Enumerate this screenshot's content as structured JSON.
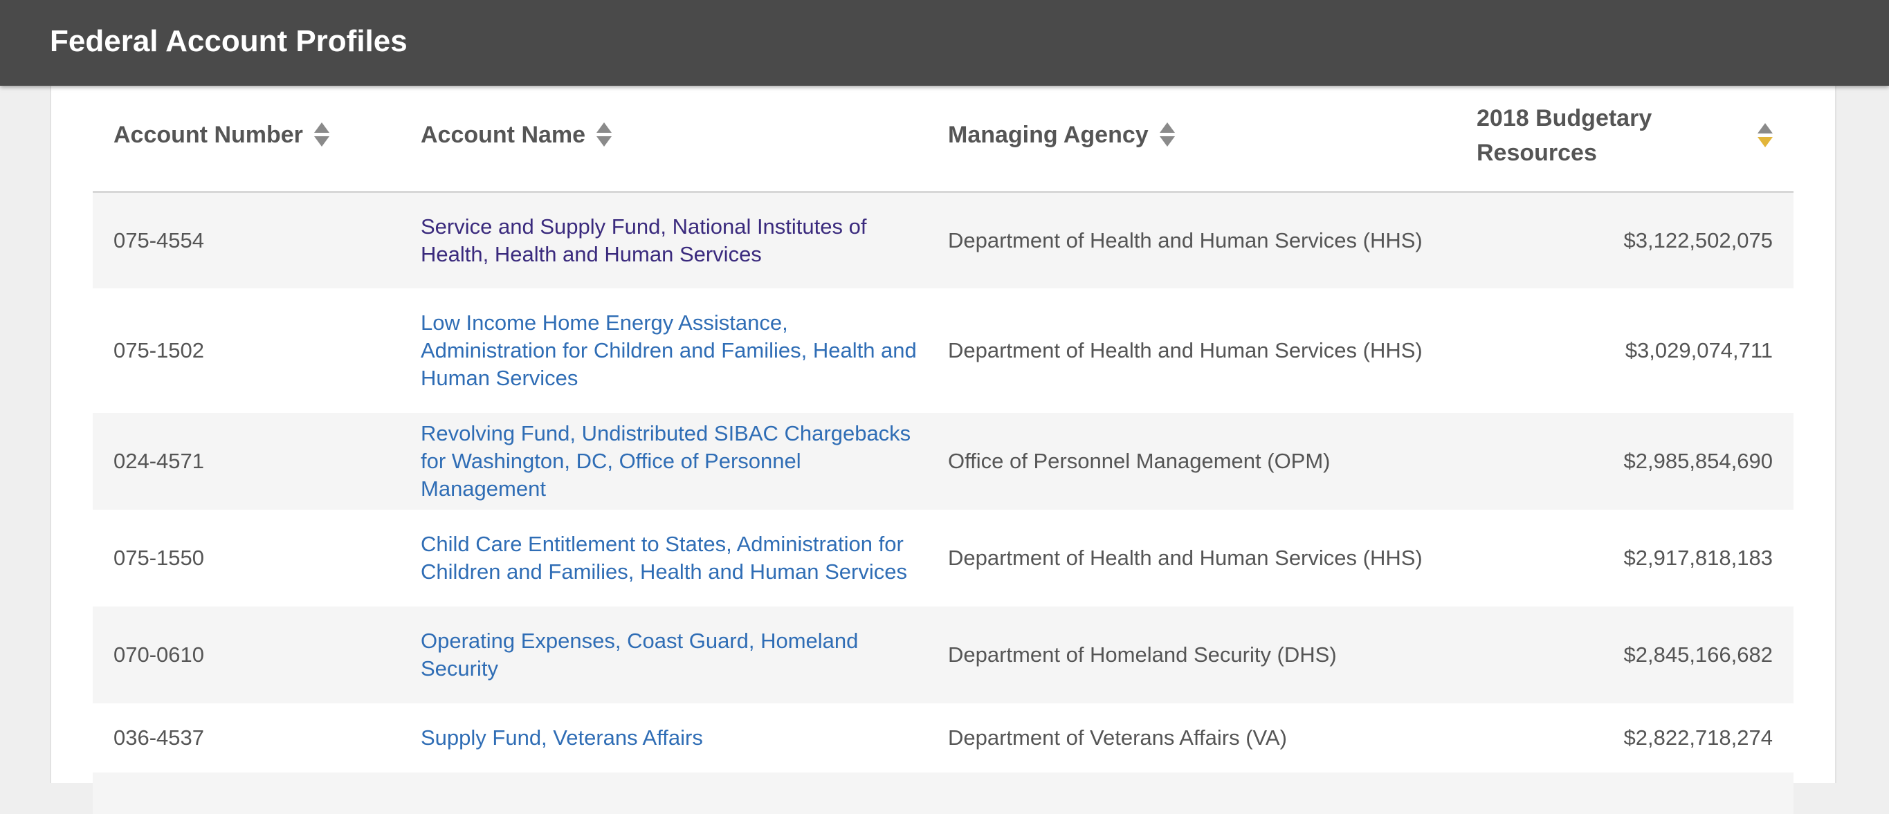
{
  "header": {
    "title": "Federal Account Profiles"
  },
  "table": {
    "columns": {
      "account_number": "Account Number",
      "account_name": "Account Name",
      "managing_agency": "Managing Agency",
      "budgetary_resources_line1": "2018 Budgetary",
      "budgetary_resources_line2": "Resources"
    },
    "sort": {
      "column": "2018 Budgetary Resources",
      "direction": "descending",
      "active_color": "#e2b53a"
    },
    "rows": [
      {
        "number": "075-4554",
        "name": "Service and Supply Fund, National Institutes of Health, Health and Human Services",
        "agency": "Department of Health and Human Services (HHS)",
        "amount": "$3,122,502,075"
      },
      {
        "number": "075-1502",
        "name": "Low Income Home Energy Assistance, Administration for Children and Families, Health and Human Services",
        "agency": "Department of Health and Human Services (HHS)",
        "amount": "$3,029,074,711"
      },
      {
        "number": "024-4571",
        "name": "Revolving Fund, Undistributed SIBAC Chargebacks for Washington, DC, Office of Personnel Management",
        "agency": "Office of Personnel Management (OPM)",
        "amount": "$2,985,854,690"
      },
      {
        "number": "075-1550",
        "name": "Child Care Entitlement to States, Administration for Children and Families, Health and Human Services",
        "agency": "Department of Health and Human Services (HHS)",
        "amount": "$2,917,818,183"
      },
      {
        "number": "070-0610",
        "name": "Operating Expenses, Coast Guard, Homeland Security",
        "agency": "Department of Homeland Security (DHS)",
        "amount": "$2,845,166,682"
      },
      {
        "number": "036-4537",
        "name": "Supply Fund, Veterans Affairs",
        "agency": "Department of Veterans Affairs (VA)",
        "amount": "$2,822,718,274"
      }
    ]
  },
  "colors": {
    "header_bg": "#4a4a4a",
    "link": "#2f6db5",
    "visited_link": "#3a2a7d",
    "row_alt": "#f5f5f5"
  }
}
